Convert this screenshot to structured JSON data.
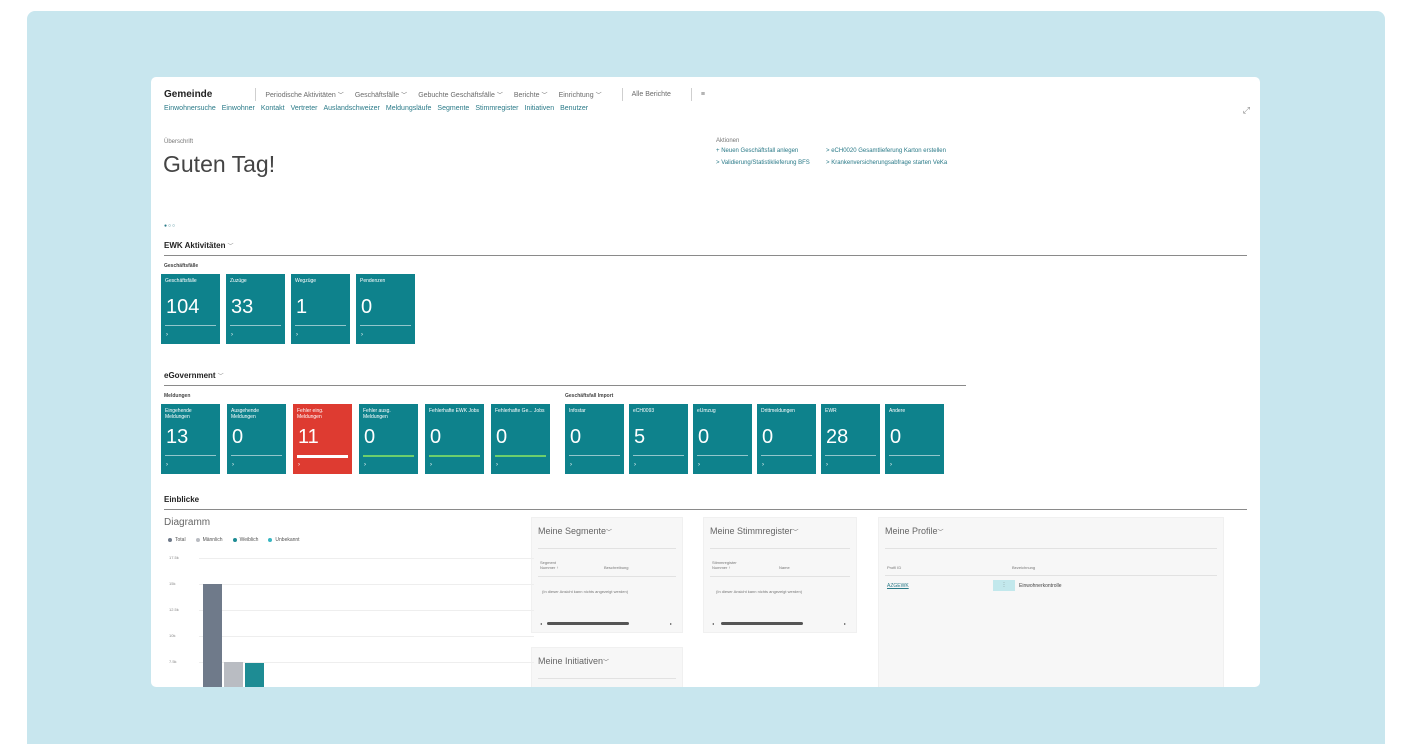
{
  "app": {
    "title": "Gemeinde",
    "menu": [
      {
        "label": "Periodische Aktivitäten",
        "chevron": true
      },
      {
        "label": "Geschäftsfälle",
        "chevron": true
      },
      {
        "label": "Gebuchte Geschäftsfälle",
        "chevron": true
      },
      {
        "label": "Berichte",
        "chevron": true
      },
      {
        "label": "Einrichtung",
        "chevron": true
      }
    ],
    "all_reports": "Alle Berichte",
    "menu_icon": "≡",
    "subnav": [
      "Einwohnersuche",
      "Einwohner",
      "Kontakt",
      "Vertreter",
      "Auslandschweizer",
      "Meldungsläufe",
      "Segmente",
      "Stimmregister",
      "Initiativen",
      "Benutzer"
    ],
    "expand_icon": "⤢"
  },
  "headline": {
    "label": "Überschrift",
    "text": "Guten Tag!"
  },
  "actions": {
    "label": "Aktionen",
    "items": [
      {
        "prefix": "+",
        "label": "Neuen Geschäftsfall anlegen"
      },
      {
        "prefix": ">",
        "label": "eCH0020 Gesamtlieferung Karton erstellen"
      },
      {
        "prefix": ">",
        "label": "Validierung/Statistiklieferung BFS"
      },
      {
        "prefix": ">",
        "label": "Krankenversicherungsabfrage starten VeKa"
      }
    ]
  },
  "pager": "●○○",
  "ewk": {
    "title": "EWK Aktivitäten",
    "group": "Geschäftsfälle",
    "tiles": [
      {
        "label": "Geschäftsfälle",
        "value": "104"
      },
      {
        "label": "Zuzüge",
        "value": "33"
      },
      {
        "label": "Wegzüge",
        "value": "1"
      },
      {
        "label": "Pendenzen",
        "value": "0"
      }
    ]
  },
  "egov": {
    "title": "eGovernment",
    "group_meldungen": "Meldungen",
    "group_import": "Geschäftsfall Import",
    "meldungen": [
      {
        "label": "Eingehende Meldungen",
        "value": "13"
      },
      {
        "label": "Ausgehende Meldungen",
        "value": "0"
      },
      {
        "label": "Fehler eing. Meldungen",
        "value": "11"
      },
      {
        "label": "Fehler ausg. Meldungen",
        "value": "0"
      },
      {
        "label": "Fehlerhafte EWK Jobs",
        "value": "0"
      },
      {
        "label": "Fehlerhafte Ge... Jobs",
        "value": "0"
      }
    ],
    "imports": [
      {
        "label": "Infostar",
        "value": "0"
      },
      {
        "label": "eCH0093",
        "value": "5"
      },
      {
        "label": "eUmzug",
        "value": "0"
      },
      {
        "label": "Drittmeldungen",
        "value": "0"
      },
      {
        "label": "EWR",
        "value": "28"
      },
      {
        "label": "Andere",
        "value": "0"
      }
    ]
  },
  "insights": {
    "title": "Einblicke",
    "chart_title": "Diagramm",
    "legend": [
      {
        "label": "Total",
        "color": "#6f7a8a"
      },
      {
        "label": "Männlich",
        "color": "#b9bcc2"
      },
      {
        "label": "Weiblich",
        "color": "#1e8c94"
      },
      {
        "label": "Unbekannt",
        "color": "#38b6c2"
      }
    ],
    "yticks": [
      "17.5k",
      "15k",
      "12.5k",
      "10k",
      "7.5k"
    ]
  },
  "chart_data": {
    "type": "bar",
    "title": "Diagramm",
    "series": [
      {
        "name": "Total",
        "values": [
          15000
        ]
      },
      {
        "name": "Männlich",
        "values": [
          7500
        ]
      },
      {
        "name": "Weiblich",
        "values": [
          7400
        ]
      },
      {
        "name": "Unbekannt",
        "values": [
          0
        ]
      }
    ],
    "yticks": [
      "17.5k",
      "15k",
      "12.5k",
      "10k",
      "7.5k"
    ]
  },
  "cards": {
    "segmente": {
      "title": "Meine Segmente",
      "col1": "Segment Nummer ↑",
      "col2": "Beschreibung",
      "empty": "(In dieser Ansicht kann nichts angezeigt werden)"
    },
    "stimmregister": {
      "title": "Meine Stimmregister",
      "col1": "Stimmregister Nummer ↑",
      "col2": "Name",
      "empty": "(In dieser Ansicht kann nichts angezeigt werden)"
    },
    "initiativen": {
      "title": "Meine Initiativen"
    },
    "profile": {
      "title": "Meine Profile",
      "col1": "Profil ID",
      "col2": "Bezeichnung",
      "row_id": "AZGEWK",
      "row_badge": "⋮",
      "row_desc": "Einwohnerkontrolle"
    }
  }
}
